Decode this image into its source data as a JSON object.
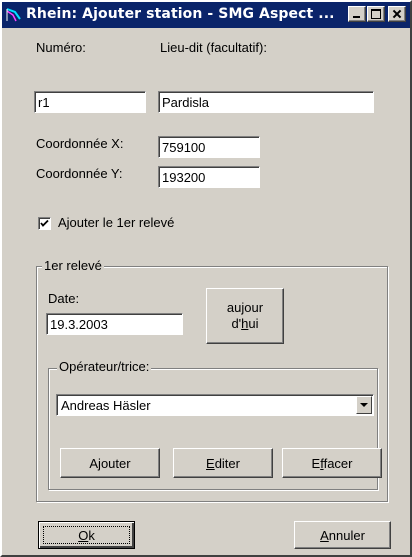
{
  "window": {
    "title": "Rhein: Ajouter station - SMG Aspect ...",
    "minimize_icon": "minimize-icon",
    "maximize_icon": "maximize-icon",
    "close_icon": "close-icon",
    "app_icon": "app-logo-icon"
  },
  "form": {
    "numero_label": "Numéro:",
    "numero_value": "r1",
    "lieu_label": "Lieu-dit (facultatif):",
    "lieu_value": "Pardisla",
    "coord_x_label": "Coordonnée X:",
    "coord_x_value": "759100",
    "coord_y_label": "Coordonnée Y:",
    "coord_y_value": "193200",
    "add_first_label": "Ajouter le 1er relevé",
    "add_first_checked": true
  },
  "releve": {
    "group_title": "1er relevé",
    "date_label": "Date:",
    "date_value": "19.3.2003",
    "today_line1": "aujour",
    "today_line2_pre": "d'",
    "today_line2_u": "h",
    "today_line2_post": "ui"
  },
  "operateur": {
    "group_title": "Opérateur/trice:",
    "selected": "Andreas Häsler",
    "add_label": "Ajouter",
    "edit_u": "E",
    "edit_rest": "diter",
    "delete_pre": "E",
    "delete_u": "f",
    "delete_post": "facer"
  },
  "footer": {
    "ok_u": "O",
    "ok_rest": "k",
    "cancel_u": "A",
    "cancel_rest": "nnuler"
  }
}
